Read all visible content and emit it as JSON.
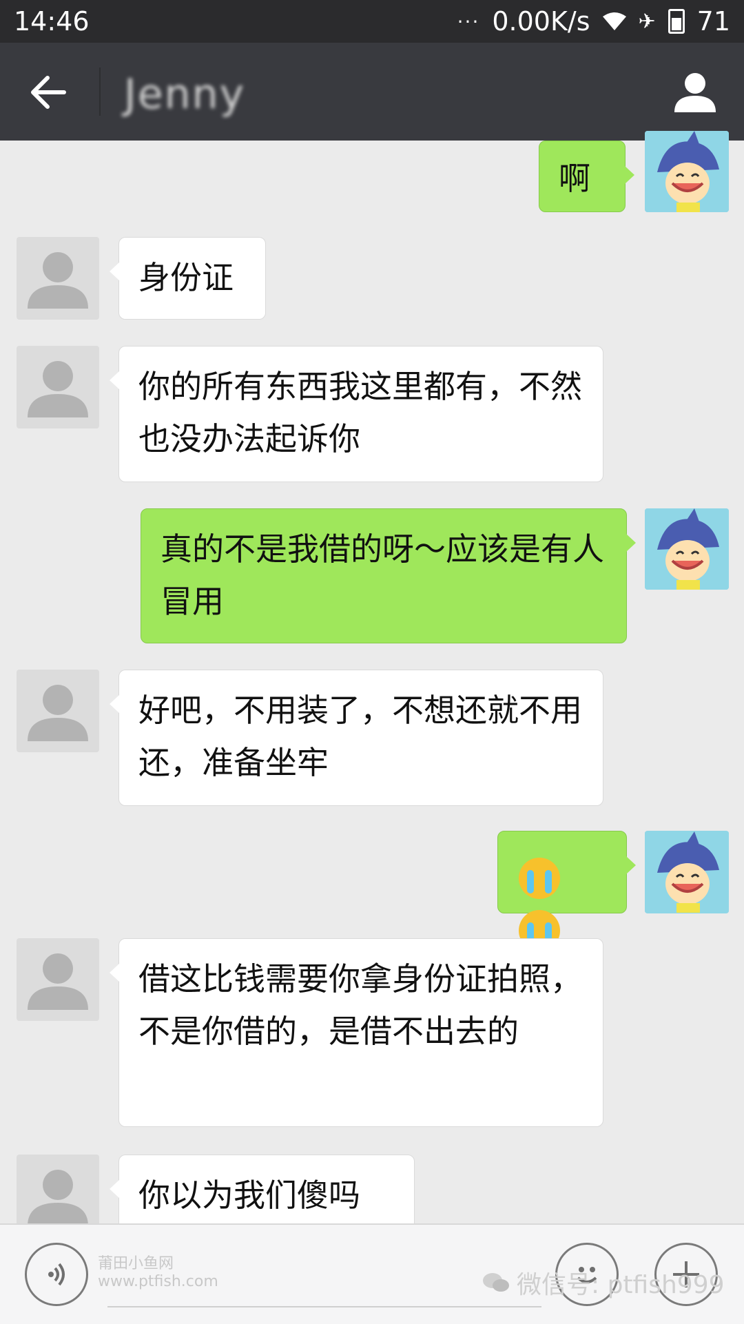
{
  "status_bar": {
    "time": "14:46",
    "signal_dots": "···",
    "network_speed": "0.00K/s",
    "battery_level": "71"
  },
  "header": {
    "title": "Jenny"
  },
  "messages": [
    {
      "sender": "me",
      "text": "啊"
    },
    {
      "sender": "other",
      "text": "身份证"
    },
    {
      "sender": "other",
      "text": "你的所有东西我这里都有，不然也没办法起诉你"
    },
    {
      "sender": "me",
      "text": "真的不是我借的呀～应该是有人冒用"
    },
    {
      "sender": "other",
      "text": "好吧，不用装了，不想还就不用还，准备坐牢"
    },
    {
      "sender": "me",
      "emoji": [
        "crying-emoji",
        "crying-emoji"
      ]
    },
    {
      "sender": "other",
      "text": "借这比钱需要你拿身份证拍照，不是你借的，是借不出去的"
    },
    {
      "sender": "other",
      "text": "你以为我们傻吗"
    }
  ],
  "watermarks": {
    "left_line1": "莆田小鱼网",
    "left_line2": "www.ptfish.com",
    "right": "微信号: ptfish999"
  },
  "colors": {
    "status_bar_bg": "#2b2b2d",
    "header_bg": "#393a3f",
    "chat_bg": "#ebebeb",
    "outgoing_bubble": "#9fe75b",
    "incoming_bubble": "#ffffff"
  }
}
